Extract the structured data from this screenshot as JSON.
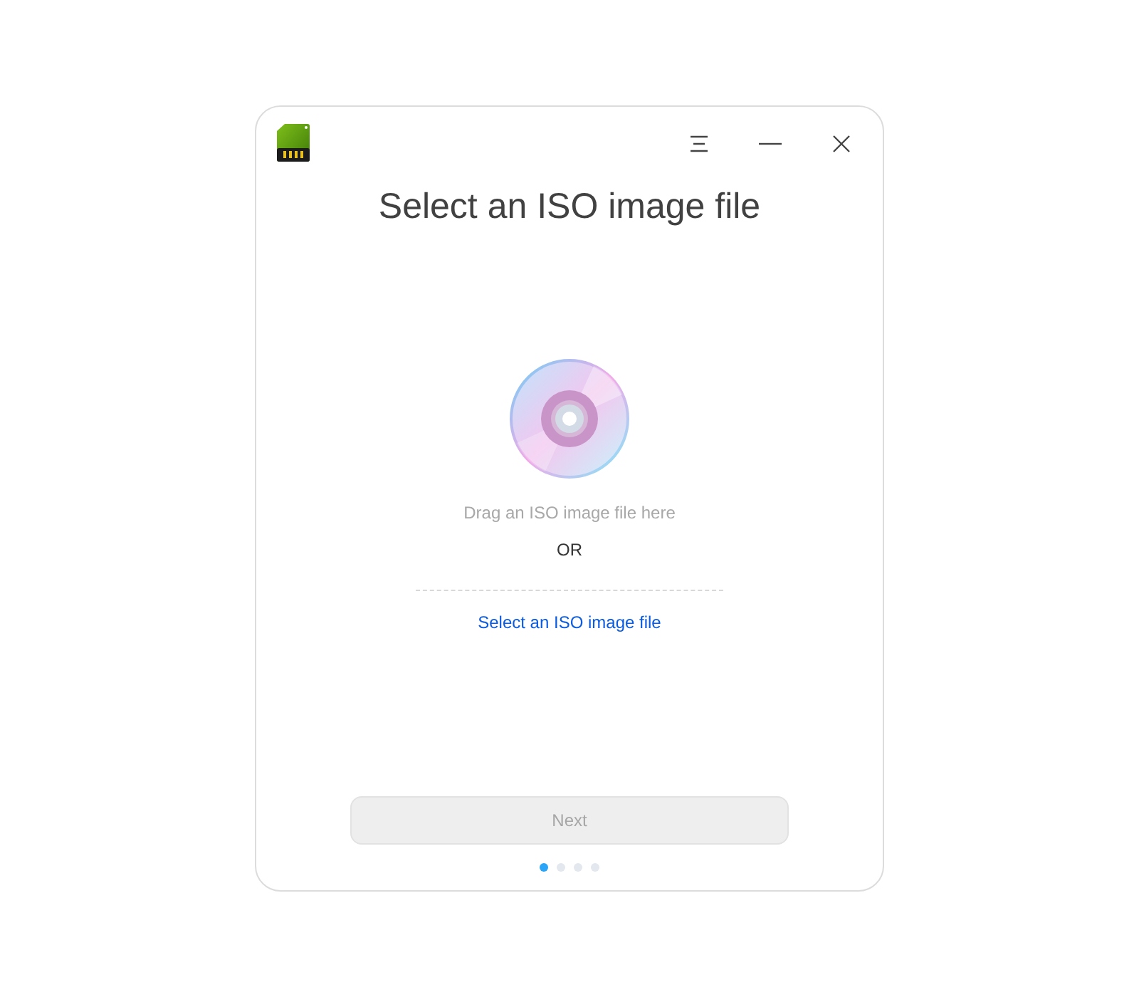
{
  "window": {
    "title": "Select an ISO image file"
  },
  "drop_area": {
    "hint": "Drag an ISO image file here",
    "separator": "OR",
    "link": "Select an ISO image file"
  },
  "next_button": {
    "label": "Next",
    "disabled": true
  },
  "steps": [
    {
      "selected": true
    },
    {
      "selected": false
    },
    {
      "selected": false
    },
    {
      "selected": false
    }
  ]
}
